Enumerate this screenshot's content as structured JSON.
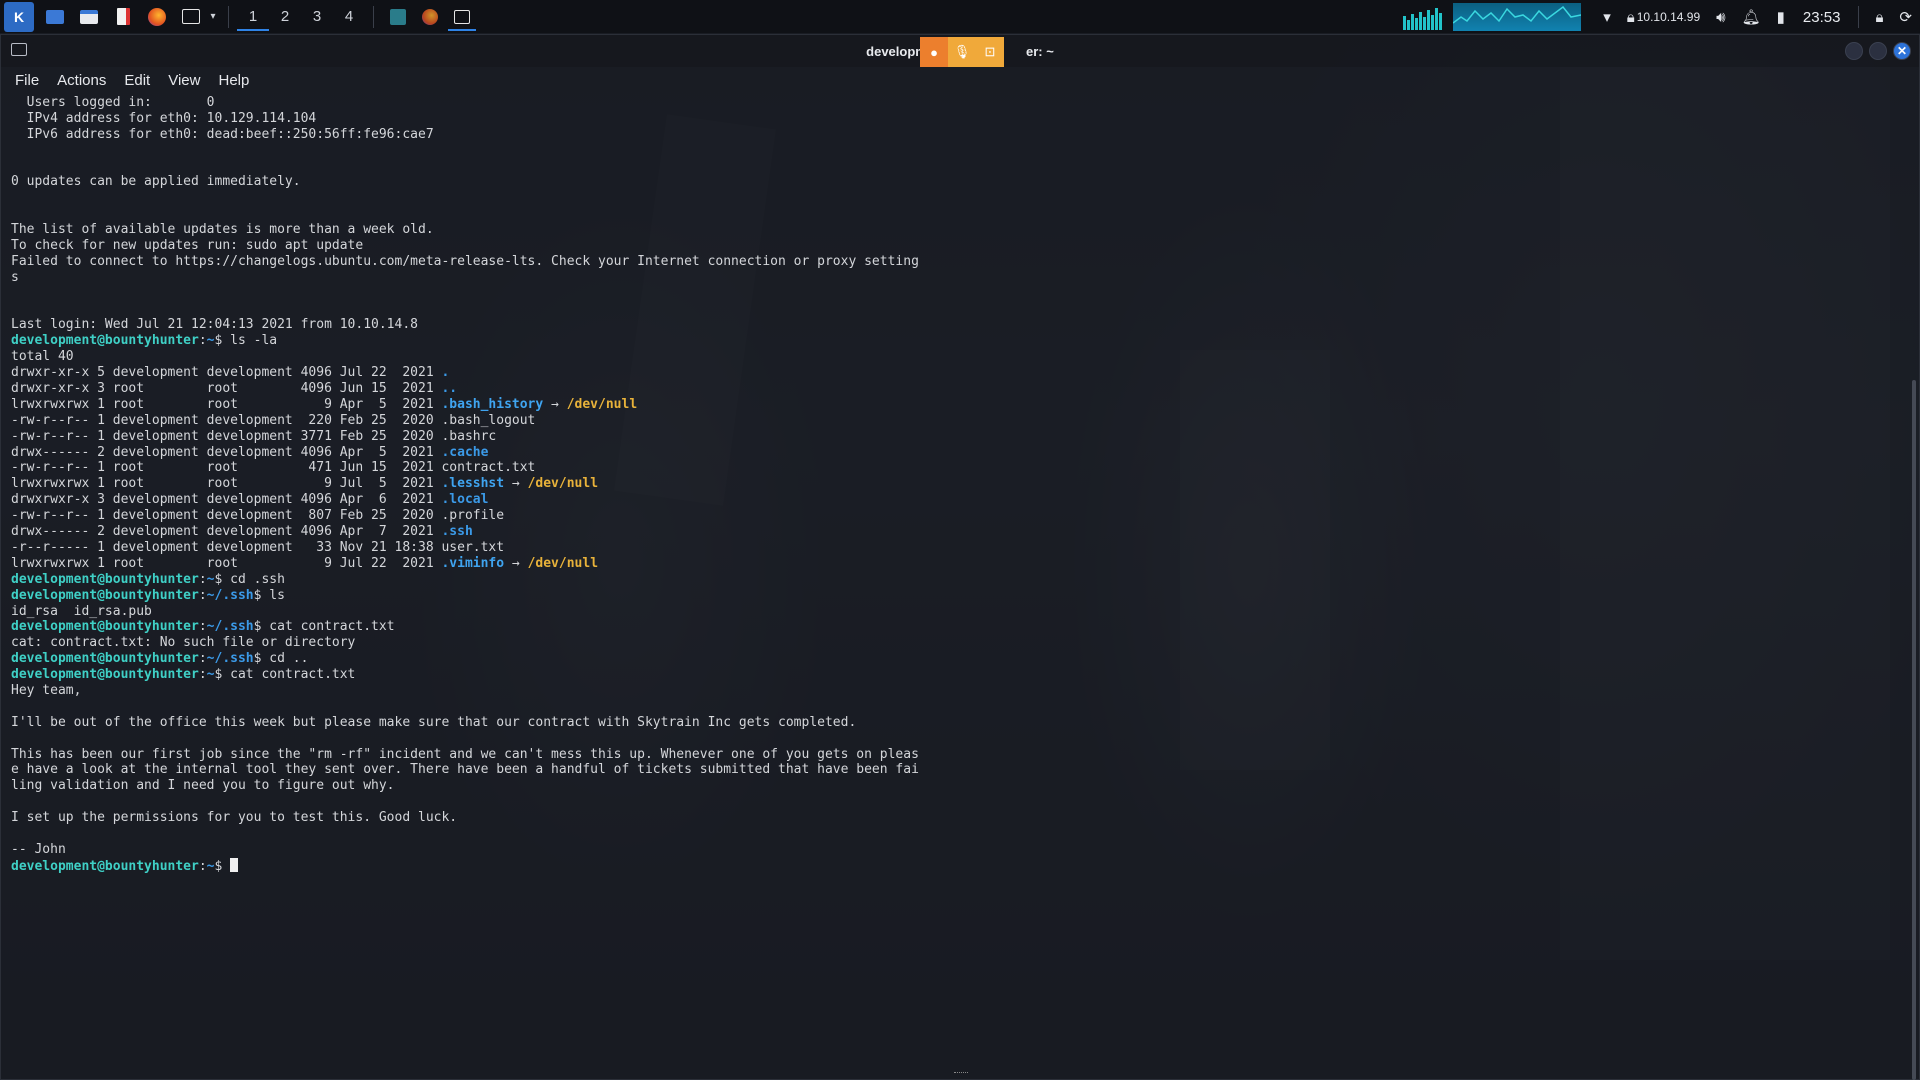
{
  "panel": {
    "workspaces": [
      "1",
      "2",
      "3",
      "4"
    ],
    "ip_display": "10.10.14.99",
    "time": "23:53"
  },
  "window": {
    "title_left": "developmen",
    "title_right": "er: ~"
  },
  "menu": [
    "File",
    "Actions",
    "Edit",
    "View",
    "Help"
  ],
  "terminal": {
    "user": "development@bountyhunter",
    "lines": [
      {
        "t": "  Users logged in:       0"
      },
      {
        "t": "  IPv4 address for eth0: 10.129.114.104"
      },
      {
        "t": "  IPv6 address for eth0: dead:beef::250:56ff:fe96:cae7"
      },
      {
        "t": ""
      },
      {
        "t": ""
      },
      {
        "t": "0 updates can be applied immediately."
      },
      {
        "t": ""
      },
      {
        "t": ""
      },
      {
        "t": "The list of available updates is more than a week old."
      },
      {
        "t": "To check for new updates run: sudo apt update"
      },
      {
        "t": "Failed to connect to https://changelogs.ubuntu.com/meta-release-lts. Check your Internet connection or proxy setting"
      },
      {
        "t": "s"
      },
      {
        "t": ""
      },
      {
        "t": ""
      },
      {
        "t": "Last login: Wed Jul 21 12:04:13 2021 from 10.10.14.8"
      },
      {
        "prompt": "development@bountyhunter",
        "path": "~",
        "cmd": "ls -la"
      },
      {
        "t": "total 40"
      },
      {
        "t": "drwxr-xr-x 5 development development 4096 Jul 22  2021 ",
        "name": ".",
        "kind": "dir"
      },
      {
        "t": "drwxr-xr-x 3 root        root        4096 Jun 15  2021 ",
        "name": "..",
        "kind": "dir"
      },
      {
        "t": "lrwxrwxrwx 1 root        root           9 Apr  5  2021 ",
        "name": ".bash_history",
        "kind": "link",
        "target": "/dev/null"
      },
      {
        "t": "-rw-r--r-- 1 development development  220 Feb 25  2020 .bash_logout"
      },
      {
        "t": "-rw-r--r-- 1 development development 3771 Feb 25  2020 .bashrc"
      },
      {
        "t": "drwx------ 2 development development 4096 Apr  5  2021 ",
        "name": ".cache",
        "kind": "dir"
      },
      {
        "t": "-rw-r--r-- 1 root        root         471 Jun 15  2021 contract.txt"
      },
      {
        "t": "lrwxrwxrwx 1 root        root           9 Jul  5  2021 ",
        "name": ".lesshst",
        "kind": "link",
        "target": "/dev/null"
      },
      {
        "t": "drwxrwxr-x 3 development development 4096 Apr  6  2021 ",
        "name": ".local",
        "kind": "dir"
      },
      {
        "t": "-rw-r--r-- 1 development development  807 Feb 25  2020 .profile"
      },
      {
        "t": "drwx------ 2 development development 4096 Apr  7  2021 ",
        "name": ".ssh",
        "kind": "dir"
      },
      {
        "t": "-r--r----- 1 development development   33 Nov 21 18:38 user.txt"
      },
      {
        "t": "lrwxrwxrwx 1 root        root           9 Jul 22  2021 ",
        "name": ".viminfo",
        "kind": "link",
        "target": "/dev/null"
      },
      {
        "prompt": "development@bountyhunter",
        "path": "~",
        "cmd": "cd .ssh"
      },
      {
        "prompt": "development@bountyhunter",
        "path": "~/.ssh",
        "cmd": "ls"
      },
      {
        "t": "id_rsa  id_rsa.pub"
      },
      {
        "prompt": "development@bountyhunter",
        "path": "~/.ssh",
        "cmd": "cat contract.txt"
      },
      {
        "t": "cat: contract.txt: No such file or directory"
      },
      {
        "prompt": "development@bountyhunter",
        "path": "~/.ssh",
        "cmd": "cd .."
      },
      {
        "prompt": "development@bountyhunter",
        "path": "~",
        "cmd": "cat contract.txt"
      },
      {
        "t": "Hey team,"
      },
      {
        "t": ""
      },
      {
        "t": "I'll be out of the office this week but please make sure that our contract with Skytrain Inc gets completed."
      },
      {
        "t": ""
      },
      {
        "t": "This has been our first job since the \"rm -rf\" incident and we can't mess this up. Whenever one of you gets on pleas"
      },
      {
        "t": "e have a look at the internal tool they sent over. There have been a handful of tickets submitted that have been fai"
      },
      {
        "t": "ling validation and I need you to figure out why."
      },
      {
        "t": ""
      },
      {
        "t": "I set up the permissions for you to test this. Good luck."
      },
      {
        "t": ""
      },
      {
        "t": "-- John"
      },
      {
        "prompt": "development@bountyhunter",
        "path": "~",
        "cmd": "",
        "cursor": true
      }
    ]
  }
}
